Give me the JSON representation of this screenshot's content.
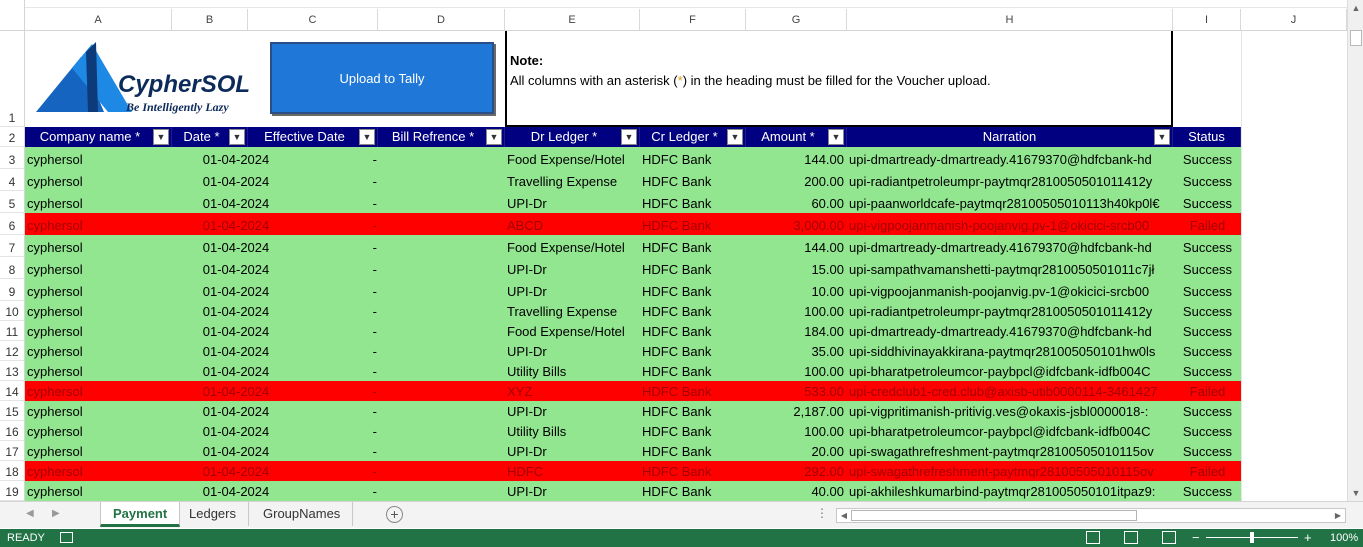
{
  "columns": [
    "A",
    "B",
    "C",
    "D",
    "E",
    "F",
    "G",
    "H",
    "I",
    "J"
  ],
  "banner": {
    "logo_brand": "CypherSOL",
    "logo_tagline": "Be Intelligently Lazy",
    "upload_button": "Upload to Tally",
    "note_title": "Note:",
    "note_text_before": "All columns with an asterisk (",
    "note_asterisk": "*",
    "note_text_after": ") in the heading must be filled for the Voucher upload."
  },
  "table": {
    "headers": [
      "Company name *",
      "Date *",
      "Effective Date",
      "Bill Refrence *",
      "Dr Ledger *",
      "Cr Ledger *",
      "Amount *",
      "Narration",
      "Status"
    ],
    "rows": [
      {
        "n": "3",
        "company": "cyphersol",
        "date": "01-04-2024",
        "eff": "-",
        "dr": "Food Expense/Hotel",
        "cr": "HDFC Bank",
        "amount": "144.00",
        "narration": "upi-dmartready-dmartready.41679370@hdfcbank-hd",
        "status": "Success",
        "state": "ok"
      },
      {
        "n": "4",
        "company": "cyphersol",
        "date": "01-04-2024",
        "eff": "-",
        "dr": "Travelling Expense",
        "cr": "HDFC Bank",
        "amount": "200.00",
        "narration": "upi-radiantpetroleumpr-paytmqr2810050501011412y",
        "status": "Success",
        "state": "ok"
      },
      {
        "n": "5",
        "company": "cyphersol",
        "date": "01-04-2024",
        "eff": "-",
        "dr": "UPI-Dr",
        "cr": "HDFC Bank",
        "amount": "60.00",
        "narration": "upi-paanworldcafe-paytmqr28100505010113h40kp0l€",
        "status": "Success",
        "state": "ok"
      },
      {
        "n": "6",
        "company": "cyphersol",
        "date": "01-04-2024",
        "eff": "-",
        "dr": "ABCD",
        "cr": "HDFC Bank",
        "amount": "3,000.00",
        "narration": "upi-vigpoojanmanish-poojanvig.pv-1@okicici-srcb00",
        "status": "Failed",
        "state": "fail"
      },
      {
        "n": "7",
        "company": "cyphersol",
        "date": "01-04-2024",
        "eff": "-",
        "dr": "Food Expense/Hotel",
        "cr": "HDFC Bank",
        "amount": "144.00",
        "narration": "upi-dmartready-dmartready.41679370@hdfcbank-hd",
        "status": "Success",
        "state": "ok"
      },
      {
        "n": "8",
        "company": "cyphersol",
        "date": "01-04-2024",
        "eff": "-",
        "dr": "UPI-Dr",
        "cr": "HDFC Bank",
        "amount": "15.00",
        "narration": "upi-sampathvamanshetti-paytmqr2810050501011c7jł",
        "status": "Success",
        "state": "ok"
      },
      {
        "n": "9",
        "company": "cyphersol",
        "date": "01-04-2024",
        "eff": "-",
        "dr": "UPI-Dr",
        "cr": "HDFC Bank",
        "amount": "10.00",
        "narration": "upi-vigpoojanmanish-poojanvig.pv-1@okicici-srcb00",
        "status": "Success",
        "state": "ok"
      },
      {
        "n": "10",
        "company": "cyphersol",
        "date": "01-04-2024",
        "eff": "-",
        "dr": "Travelling Expense",
        "cr": "HDFC Bank",
        "amount": "100.00",
        "narration": "upi-radiantpetroleumpr-paytmqr2810050501011412y",
        "status": "Success",
        "state": "ok"
      },
      {
        "n": "11",
        "company": "cyphersol",
        "date": "01-04-2024",
        "eff": "-",
        "dr": "Food Expense/Hotel",
        "cr": "HDFC Bank",
        "amount": "184.00",
        "narration": "upi-dmartready-dmartready.41679370@hdfcbank-hd",
        "status": "Success",
        "state": "ok"
      },
      {
        "n": "12",
        "company": "cyphersol",
        "date": "01-04-2024",
        "eff": "-",
        "dr": "UPI-Dr",
        "cr": "HDFC Bank",
        "amount": "35.00",
        "narration": "upi-siddhivinayakkirana-paytmqr281005050101hw0ls",
        "status": "Success",
        "state": "ok"
      },
      {
        "n": "13",
        "company": "cyphersol",
        "date": "01-04-2024",
        "eff": "-",
        "dr": "Utility Bills",
        "cr": "HDFC Bank",
        "amount": "100.00",
        "narration": "upi-bharatpetroleumcor-paybpcl@idfcbank-idfb004C",
        "status": "Success",
        "state": "ok"
      },
      {
        "n": "14",
        "company": "cyphersol",
        "date": "01-04-2024",
        "eff": "-",
        "dr": "XYZ",
        "cr": "HDFC Bank",
        "amount": "533.00",
        "narration": "upi-credclub1-cred.club@axisb-utib0000114-3461427",
        "status": "Failed",
        "state": "fail"
      },
      {
        "n": "15",
        "company": "cyphersol",
        "date": "01-04-2024",
        "eff": "-",
        "dr": "UPI-Dr",
        "cr": "HDFC Bank",
        "amount": "2,187.00",
        "narration": "upi-vigpritimanish-pritivig.ves@okaxis-jsbl0000018-:",
        "status": "Success",
        "state": "ok"
      },
      {
        "n": "16",
        "company": "cyphersol",
        "date": "01-04-2024",
        "eff": "-",
        "dr": "Utility Bills",
        "cr": "HDFC Bank",
        "amount": "100.00",
        "narration": "upi-bharatpetroleumcor-paybpcl@idfcbank-idfb004C",
        "status": "Success",
        "state": "ok"
      },
      {
        "n": "17",
        "company": "cyphersol",
        "date": "01-04-2024",
        "eff": "-",
        "dr": "UPI-Dr",
        "cr": "HDFC Bank",
        "amount": "20.00",
        "narration": "upi-swagathrefreshment-paytmqr28100505010115ov",
        "status": "Success",
        "state": "ok"
      },
      {
        "n": "18",
        "company": "cyphersol",
        "date": "01-04-2024",
        "eff": "-",
        "dr": "HDFC",
        "cr": "HDFC Bank",
        "amount": "292.00",
        "narration": "upi-swagathrefreshment-paytmqr28100505010115ov",
        "status": "Failed",
        "state": "fail"
      },
      {
        "n": "19",
        "company": "cyphersol",
        "date": "01-04-2024",
        "eff": "-",
        "dr": "UPI-Dr",
        "cr": "HDFC Bank",
        "amount": "40.00",
        "narration": "upi-akhileshkumarbind-paytmqr281005050101itpaz9:",
        "status": "Success",
        "state": "ok"
      }
    ]
  },
  "sheets": [
    "Payment",
    "Ledgers",
    "GroupNames"
  ],
  "active_sheet": "Payment",
  "status": {
    "ready": "READY",
    "zoom": "100%"
  },
  "colors": {
    "ok": "#92e690",
    "fail": "#ff0000",
    "header": "#000080",
    "excel_green": "#217346",
    "button": "#1f78d8"
  }
}
